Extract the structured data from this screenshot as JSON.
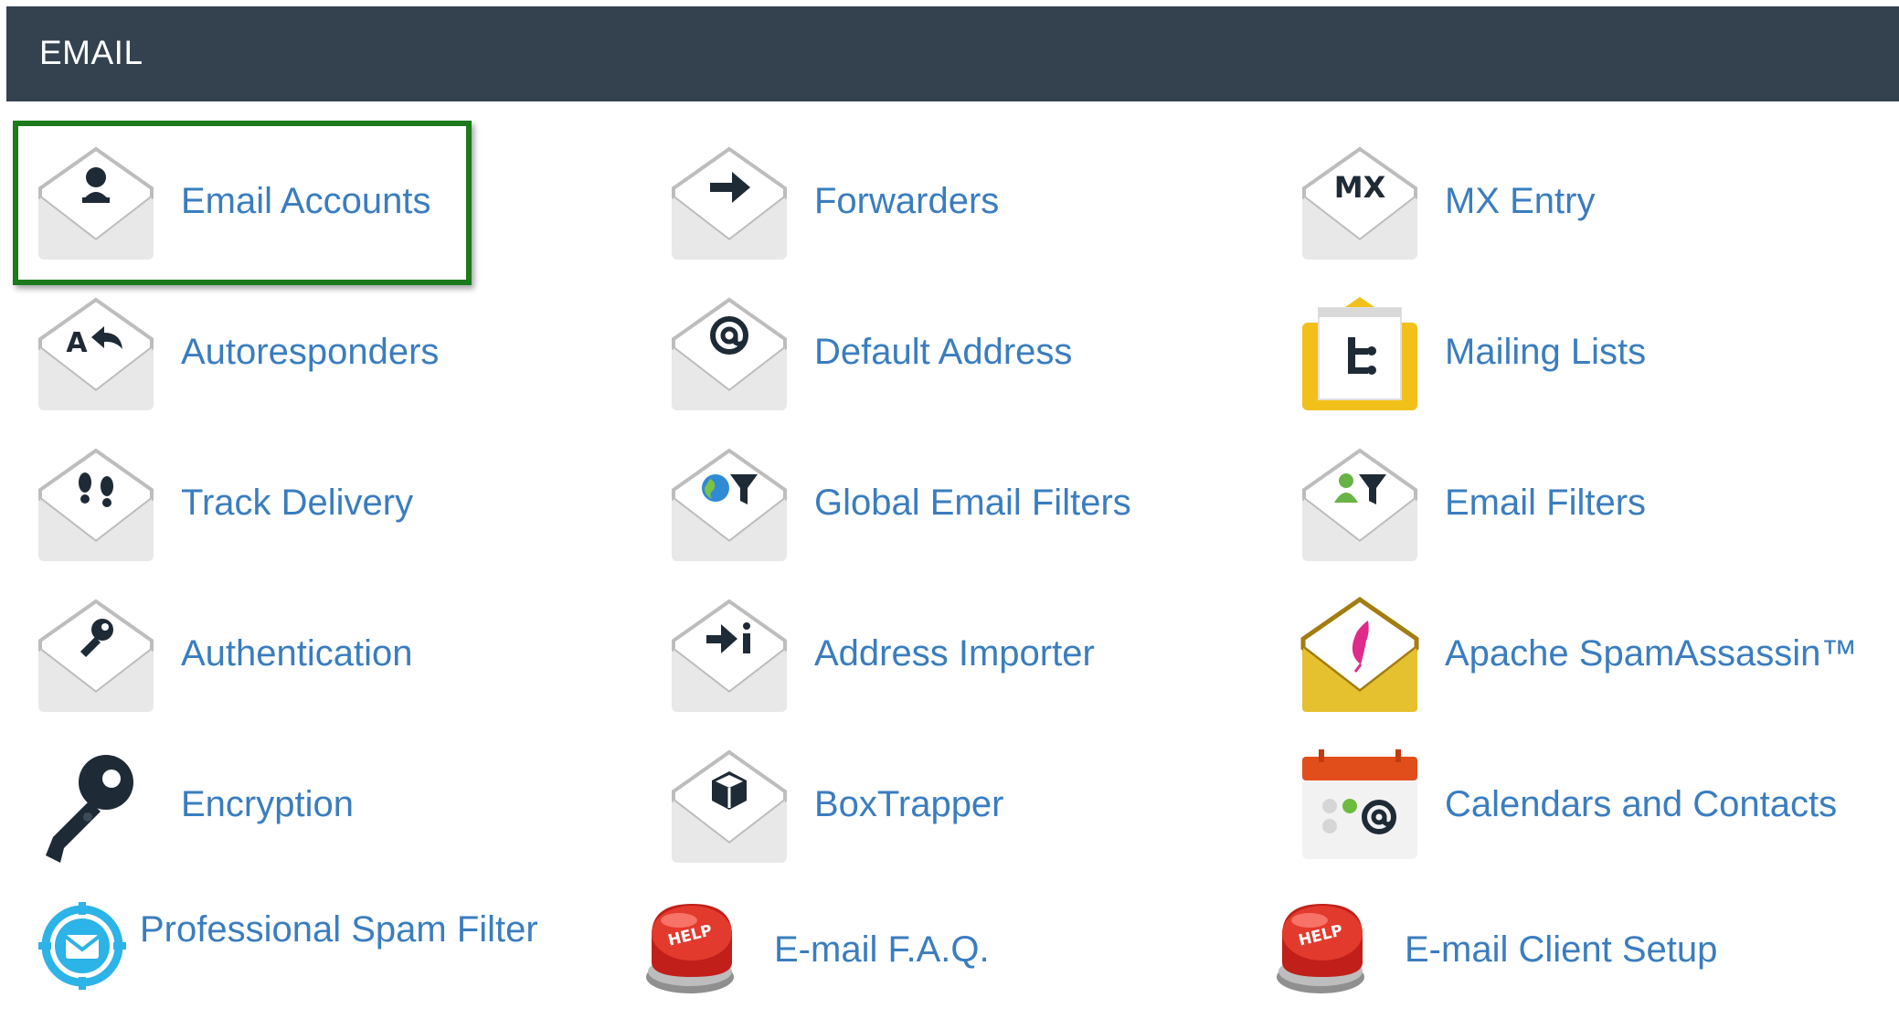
{
  "section": {
    "title": "EMAIL"
  },
  "tools": [
    {
      "id": "email-accounts",
      "label": "Email Accounts",
      "icon": "user-icon"
    },
    {
      "id": "forwarders",
      "label": "Forwarders",
      "icon": "arrow-right-icon"
    },
    {
      "id": "mx-entry",
      "label": "MX Entry",
      "icon": "mx-icon"
    },
    {
      "id": "autoresponders",
      "label": "Autoresponders",
      "icon": "reply-icon"
    },
    {
      "id": "default-address",
      "label": "Default Address",
      "icon": "at-sign-icon"
    },
    {
      "id": "mailing-lists",
      "label": "Mailing Lists",
      "icon": "mailing-list-icon"
    },
    {
      "id": "track-delivery",
      "label": "Track Delivery",
      "icon": "footprints-icon"
    },
    {
      "id": "global-email-filters",
      "label": "Global Email Filters",
      "icon": "globe-filter-icon"
    },
    {
      "id": "email-filters",
      "label": "Email Filters",
      "icon": "user-filter-icon"
    },
    {
      "id": "authentication",
      "label": "Authentication",
      "icon": "key-icon"
    },
    {
      "id": "address-importer",
      "label": "Address Importer",
      "icon": "import-icon"
    },
    {
      "id": "apache-spamassassin",
      "label": "Apache SpamAssassin™",
      "icon": "feather-icon"
    },
    {
      "id": "encryption",
      "label": "Encryption",
      "icon": "key-icon"
    },
    {
      "id": "boxtrapper",
      "label": "BoxTrapper",
      "icon": "box-icon"
    },
    {
      "id": "calendars-and-contacts",
      "label": "Calendars and Contacts",
      "icon": "calendar-icon"
    },
    {
      "id": "professional-spam-filter",
      "label": "Professional Spam Filter",
      "icon": "spam-filter-icon"
    },
    {
      "id": "email-faq",
      "label": "E-mail F.A.Q.",
      "icon": "help-button-icon"
    },
    {
      "id": "email-client-setup",
      "label": "E-mail Client Setup",
      "icon": "help-button-icon"
    }
  ],
  "icon_badges": {
    "mx": "MX",
    "help": "HELP",
    "import_letter": "i",
    "reply_letter": "A"
  },
  "colors": {
    "header_bg": "#344250",
    "link": "#3a7dbf",
    "highlight_border": "#1c7a1c",
    "envelope_gray": "#e6e6e6",
    "glyph_dark": "#1e2a36",
    "mailing_yellow": "#f2c01a",
    "spamassassin_yellow": "#e6c12f",
    "help_red": "#d8261e",
    "spam_filter_blue": "#2cb3e8"
  }
}
